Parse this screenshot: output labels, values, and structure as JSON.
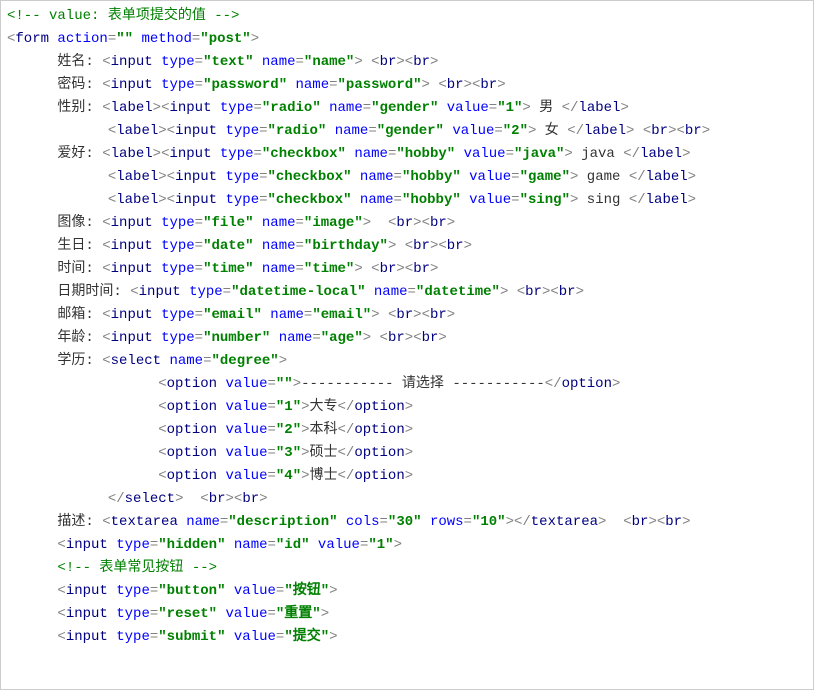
{
  "lines": [
    {
      "indent": 0,
      "seg": [
        {
          "t": "comment",
          "v": "<!-- value: 表单项提交的值 -->"
        }
      ]
    },
    {
      "indent": 0,
      "seg": [
        {
          "t": "open",
          "tag": "form",
          "attrs": [
            {
              "n": "action",
              "v": ""
            },
            {
              "n": "method",
              "v": "post"
            }
          ]
        }
      ]
    },
    {
      "indent": 6,
      "seg": [
        {
          "t": "text",
          "v": "姓名: "
        },
        {
          "t": "open",
          "tag": "input",
          "attrs": [
            {
              "n": "type",
              "v": "text"
            },
            {
              "n": "name",
              "v": "name"
            }
          ]
        },
        {
          "t": "text",
          "v": " "
        },
        {
          "t": "open",
          "tag": "br"
        },
        {
          "t": "open",
          "tag": "br"
        }
      ]
    },
    {
      "indent": 6,
      "seg": [
        {
          "t": "text",
          "v": "密码: "
        },
        {
          "t": "open",
          "tag": "input",
          "attrs": [
            {
              "n": "type",
              "v": "password"
            },
            {
              "n": "name",
              "v": "password"
            }
          ]
        },
        {
          "t": "text",
          "v": " "
        },
        {
          "t": "open",
          "tag": "br"
        },
        {
          "t": "open",
          "tag": "br"
        }
      ]
    },
    {
      "indent": 6,
      "seg": [
        {
          "t": "text",
          "v": "性别: "
        },
        {
          "t": "open",
          "tag": "label"
        },
        {
          "t": "open",
          "tag": "input",
          "attrs": [
            {
              "n": "type",
              "v": "radio"
            },
            {
              "n": "name",
              "v": "gender"
            },
            {
              "n": "value",
              "v": "1"
            }
          ]
        },
        {
          "t": "text",
          "v": " 男 "
        },
        {
          "t": "close",
          "tag": "label"
        }
      ]
    },
    {
      "indent": 12,
      "seg": [
        {
          "t": "open",
          "tag": "label"
        },
        {
          "t": "open",
          "tag": "input",
          "attrs": [
            {
              "n": "type",
              "v": "radio"
            },
            {
              "n": "name",
              "v": "gender"
            },
            {
              "n": "value",
              "v": "2"
            }
          ]
        },
        {
          "t": "text",
          "v": " 女 "
        },
        {
          "t": "close",
          "tag": "label"
        },
        {
          "t": "text",
          "v": " "
        },
        {
          "t": "open",
          "tag": "br"
        },
        {
          "t": "open",
          "tag": "br"
        }
      ]
    },
    {
      "indent": 6,
      "seg": [
        {
          "t": "text",
          "v": "爱好: "
        },
        {
          "t": "open",
          "tag": "label"
        },
        {
          "t": "open",
          "tag": "input",
          "attrs": [
            {
              "n": "type",
              "v": "checkbox"
            },
            {
              "n": "name",
              "v": "hobby"
            },
            {
              "n": "value",
              "v": "java"
            }
          ]
        },
        {
          "t": "text",
          "v": " java "
        },
        {
          "t": "close",
          "tag": "label"
        }
      ]
    },
    {
      "indent": 12,
      "seg": [
        {
          "t": "open",
          "tag": "label"
        },
        {
          "t": "open",
          "tag": "input",
          "attrs": [
            {
              "n": "type",
              "v": "checkbox"
            },
            {
              "n": "name",
              "v": "hobby"
            },
            {
              "n": "value",
              "v": "game"
            }
          ]
        },
        {
          "t": "text",
          "v": " game "
        },
        {
          "t": "close",
          "tag": "label"
        }
      ]
    },
    {
      "indent": 12,
      "seg": [
        {
          "t": "open",
          "tag": "label"
        },
        {
          "t": "open",
          "tag": "input",
          "attrs": [
            {
              "n": "type",
              "v": "checkbox"
            },
            {
              "n": "name",
              "v": "hobby"
            },
            {
              "n": "value",
              "v": "sing"
            }
          ]
        },
        {
          "t": "text",
          "v": " sing "
        },
        {
          "t": "close",
          "tag": "label"
        }
      ]
    },
    {
      "indent": 6,
      "seg": [
        {
          "t": "text",
          "v": "图像: "
        },
        {
          "t": "open",
          "tag": "input",
          "attrs": [
            {
              "n": "type",
              "v": "file"
            },
            {
              "n": "name",
              "v": "image"
            }
          ]
        },
        {
          "t": "text",
          "v": "  "
        },
        {
          "t": "open",
          "tag": "br"
        },
        {
          "t": "open",
          "tag": "br"
        }
      ]
    },
    {
      "indent": 6,
      "seg": [
        {
          "t": "text",
          "v": "生日: "
        },
        {
          "t": "open",
          "tag": "input",
          "attrs": [
            {
              "n": "type",
              "v": "date"
            },
            {
              "n": "name",
              "v": "birthday"
            }
          ]
        },
        {
          "t": "text",
          "v": " "
        },
        {
          "t": "open",
          "tag": "br"
        },
        {
          "t": "open",
          "tag": "br"
        }
      ]
    },
    {
      "indent": 6,
      "seg": [
        {
          "t": "text",
          "v": "时间: "
        },
        {
          "t": "open",
          "tag": "input",
          "attrs": [
            {
              "n": "type",
              "v": "time"
            },
            {
              "n": "name",
              "v": "time"
            }
          ]
        },
        {
          "t": "text",
          "v": " "
        },
        {
          "t": "open",
          "tag": "br"
        },
        {
          "t": "open",
          "tag": "br"
        }
      ]
    },
    {
      "indent": 6,
      "seg": [
        {
          "t": "text",
          "v": "日期时间: "
        },
        {
          "t": "open",
          "tag": "input",
          "attrs": [
            {
              "n": "type",
              "v": "datetime-local"
            },
            {
              "n": "name",
              "v": "datetime"
            }
          ]
        },
        {
          "t": "text",
          "v": " "
        },
        {
          "t": "open",
          "tag": "br"
        },
        {
          "t": "open",
          "tag": "br"
        }
      ]
    },
    {
      "indent": 6,
      "seg": [
        {
          "t": "text",
          "v": "邮箱: "
        },
        {
          "t": "open",
          "tag": "input",
          "attrs": [
            {
              "n": "type",
              "v": "email"
            },
            {
              "n": "name",
              "v": "email"
            }
          ]
        },
        {
          "t": "text",
          "v": " "
        },
        {
          "t": "open",
          "tag": "br"
        },
        {
          "t": "open",
          "tag": "br"
        }
      ]
    },
    {
      "indent": 6,
      "seg": [
        {
          "t": "text",
          "v": "年龄: "
        },
        {
          "t": "open",
          "tag": "input",
          "attrs": [
            {
              "n": "type",
              "v": "number"
            },
            {
              "n": "name",
              "v": "age"
            }
          ]
        },
        {
          "t": "text",
          "v": " "
        },
        {
          "t": "open",
          "tag": "br"
        },
        {
          "t": "open",
          "tag": "br"
        }
      ]
    },
    {
      "indent": 6,
      "seg": [
        {
          "t": "text",
          "v": "学历: "
        },
        {
          "t": "open",
          "tag": "select",
          "attrs": [
            {
              "n": "name",
              "v": "degree"
            }
          ]
        }
      ]
    },
    {
      "indent": 18,
      "seg": [
        {
          "t": "open",
          "tag": "option",
          "attrs": [
            {
              "n": "value",
              "v": ""
            }
          ]
        },
        {
          "t": "text",
          "v": "----------- 请选择 -----------"
        },
        {
          "t": "close",
          "tag": "option"
        }
      ]
    },
    {
      "indent": 18,
      "seg": [
        {
          "t": "open",
          "tag": "option",
          "attrs": [
            {
              "n": "value",
              "v": "1"
            }
          ]
        },
        {
          "t": "text",
          "v": "大专"
        },
        {
          "t": "close",
          "tag": "option"
        }
      ]
    },
    {
      "indent": 18,
      "seg": [
        {
          "t": "open",
          "tag": "option",
          "attrs": [
            {
              "n": "value",
              "v": "2"
            }
          ]
        },
        {
          "t": "text",
          "v": "本科"
        },
        {
          "t": "close",
          "tag": "option"
        }
      ]
    },
    {
      "indent": 18,
      "seg": [
        {
          "t": "open",
          "tag": "option",
          "attrs": [
            {
              "n": "value",
              "v": "3"
            }
          ]
        },
        {
          "t": "text",
          "v": "硕士"
        },
        {
          "t": "close",
          "tag": "option"
        }
      ]
    },
    {
      "indent": 18,
      "seg": [
        {
          "t": "open",
          "tag": "option",
          "attrs": [
            {
              "n": "value",
              "v": "4"
            }
          ]
        },
        {
          "t": "text",
          "v": "博士"
        },
        {
          "t": "close",
          "tag": "option"
        }
      ]
    },
    {
      "indent": 12,
      "seg": [
        {
          "t": "close",
          "tag": "select"
        },
        {
          "t": "text",
          "v": "  "
        },
        {
          "t": "open",
          "tag": "br"
        },
        {
          "t": "open",
          "tag": "br"
        }
      ]
    },
    {
      "indent": 6,
      "seg": [
        {
          "t": "text",
          "v": "描述: "
        },
        {
          "t": "open",
          "tag": "textarea",
          "attrs": [
            {
              "n": "name",
              "v": "description"
            },
            {
              "n": "cols",
              "v": "30"
            },
            {
              "n": "rows",
              "v": "10"
            }
          ]
        },
        {
          "t": "close",
          "tag": "textarea"
        },
        {
          "t": "text",
          "v": "  "
        },
        {
          "t": "open",
          "tag": "br"
        },
        {
          "t": "open",
          "tag": "br"
        }
      ]
    },
    {
      "indent": 6,
      "seg": [
        {
          "t": "open",
          "tag": "input",
          "attrs": [
            {
              "n": "type",
              "v": "hidden"
            },
            {
              "n": "name",
              "v": "id"
            },
            {
              "n": "value",
              "v": "1"
            }
          ]
        }
      ]
    },
    {
      "indent": 0,
      "seg": [
        {
          "t": "text",
          "v": ""
        }
      ]
    },
    {
      "indent": 6,
      "seg": [
        {
          "t": "comment",
          "v": "<!-- 表单常见按钮 -->"
        }
      ]
    },
    {
      "indent": 6,
      "seg": [
        {
          "t": "open",
          "tag": "input",
          "attrs": [
            {
              "n": "type",
              "v": "button"
            },
            {
              "n": "value",
              "v": "按钮"
            }
          ]
        }
      ]
    },
    {
      "indent": 6,
      "seg": [
        {
          "t": "open",
          "tag": "input",
          "attrs": [
            {
              "n": "type",
              "v": "reset"
            },
            {
              "n": "value",
              "v": "重置"
            }
          ]
        }
      ]
    },
    {
      "indent": 6,
      "seg": [
        {
          "t": "open",
          "tag": "input",
          "attrs": [
            {
              "n": "type",
              "v": "submit"
            },
            {
              "n": "value",
              "v": "提交"
            }
          ]
        }
      ]
    }
  ]
}
